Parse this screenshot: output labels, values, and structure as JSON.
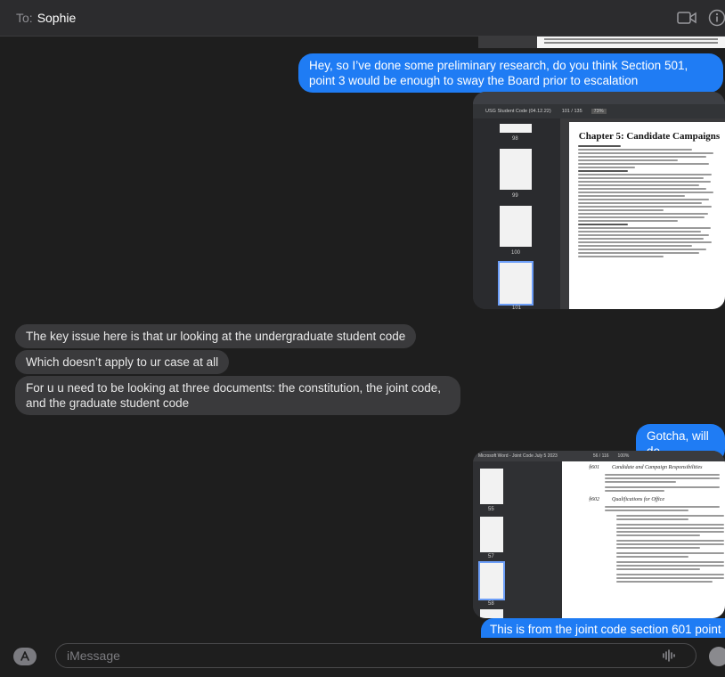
{
  "header": {
    "to_label": "To:",
    "recipient": "Sophie"
  },
  "messages": [
    {
      "id": "m1",
      "direction": "sent",
      "text": "Hey, so I’ve done some preliminary research, do you think Section 501, point 3 would be enough to sway the Board prior to escalation"
    },
    {
      "id": "m2",
      "direction": "recv",
      "text": "The key issue here is that ur looking at the undergraduate student code"
    },
    {
      "id": "m3",
      "direction": "recv",
      "text": "Which doesn’t apply to ur case at all"
    },
    {
      "id": "m4",
      "direction": "recv",
      "text": "For u u need to be looking at three documents: the constitution, the joint code, and the graduate student code"
    },
    {
      "id": "m5",
      "direction": "sent",
      "text": "Gotcha, will do"
    },
    {
      "id": "m6",
      "direction": "sent",
      "text": "This is from the joint code section 601 point"
    }
  ],
  "attachment1": {
    "doc_title": "USG Student Code (04.12.22)",
    "page_indicator": "101 / 135",
    "zoom": "73%",
    "chapter_title": "Chapter 5: Candidate Campaigns",
    "thumb_numbers": [
      "98",
      "99",
      "100",
      "101"
    ]
  },
  "attachment2": {
    "doc_title": "Microsoft Word - Joint Code July 5 2023",
    "page_indicator": "56 / 116",
    "zoom": "100%",
    "section_601": "§601",
    "section_601_title": "Candidate and Campaign Responsibilities",
    "section_602": "§602",
    "section_602_title": "Qualifications for Office",
    "thumb_numbers": [
      "55",
      "57",
      "58"
    ]
  },
  "composer": {
    "placeholder": "iMessage"
  },
  "icons": {
    "video": "video-camera-icon",
    "info": "info-icon",
    "apps": "app-store-icon",
    "voice": "waveform-icon",
    "emoji": "emoji-icon"
  },
  "colors": {
    "sent_bubble": "#1f7cf4",
    "received_bubble": "#3a3a3c",
    "background": "#1e1e1e"
  }
}
